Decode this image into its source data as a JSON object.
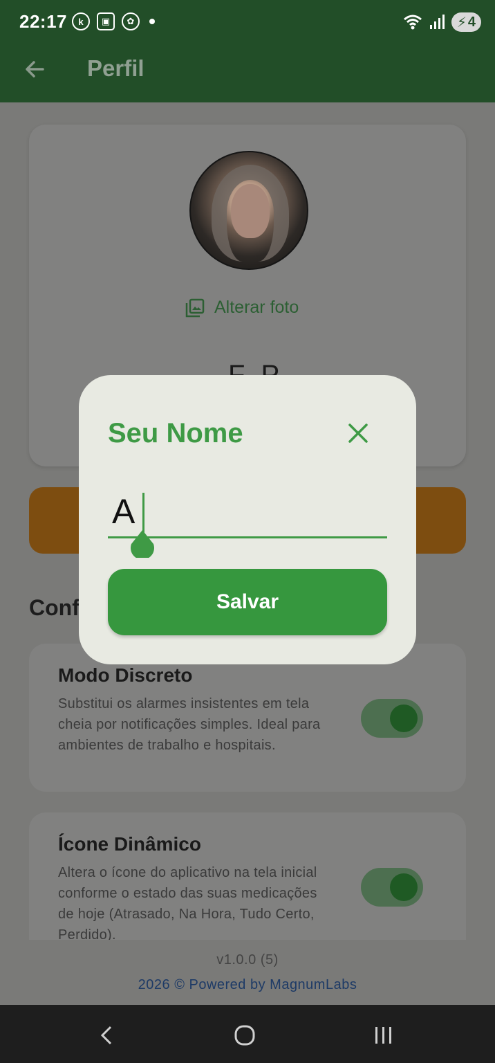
{
  "status_bar": {
    "time": "22:17",
    "left_icons": [
      "k-badge-icon",
      "screenshot-icon",
      "openai-icon",
      "dot-icon"
    ],
    "right_icons": [
      "wifi-icon",
      "signal-icon"
    ],
    "battery_level": "4"
  },
  "app_bar": {
    "title": "Perfil"
  },
  "profile": {
    "change_photo_label": "Alterar foto",
    "name_partial": "F P"
  },
  "settings": {
    "section_title_partial": "Conf",
    "items": [
      {
        "title": "Modo Discreto",
        "description": "Substitui os alarmes insistentes em tela cheia por notificações simples. Ideal para ambientes de trabalho e hospitais.",
        "enabled": true
      },
      {
        "title": "Ícone Dinâmico",
        "description": "Altera o ícone do aplicativo na tela inicial conforme o estado das suas medicações de hoje (Atrasado, Na Hora, Tudo Certo, Perdido).",
        "enabled": true
      }
    ]
  },
  "footer": {
    "version": "v1.0.0 (5)",
    "powered": "2026 © Powered by MagnumLabs"
  },
  "dialog": {
    "title": "Seu Nome",
    "input_value": "A",
    "save_label": "Salvar"
  },
  "colors": {
    "brand_green": "#3e9a45",
    "app_bar": "#224e28",
    "accent_orange": "#7d4d10"
  }
}
